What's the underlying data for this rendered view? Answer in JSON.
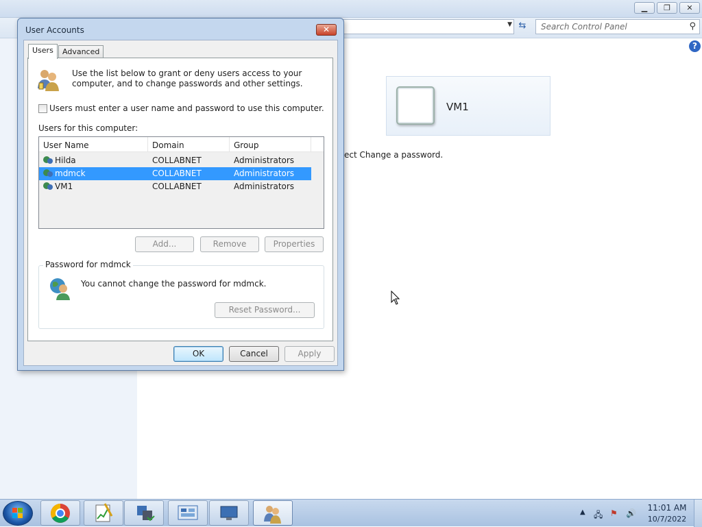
{
  "background_window": {
    "search_placeholder": "Search Control Panel",
    "help_glyph": "?",
    "user_tile_name": "VM1",
    "instruction_text": "ect Change a password."
  },
  "dialog": {
    "title": "User Accounts",
    "close_glyph": "✕",
    "tabs": [
      {
        "label": "Users"
      },
      {
        "label": "Advanced"
      }
    ],
    "intro_text": "Use the list below to grant or deny users access to your computer, and to change passwords and other settings.",
    "must_logon_label": "Users must enter a user name and password to use this computer.",
    "must_logon_checked": false,
    "users_heading": "Users for this computer:",
    "columns": [
      "User Name",
      "Domain",
      "Group"
    ],
    "users": [
      {
        "name": "Hilda",
        "domain": "COLLABNET",
        "group": "Administrators",
        "selected": false
      },
      {
        "name": "mdmck",
        "domain": "COLLABNET",
        "group": "Administrators",
        "selected": true
      },
      {
        "name": "VM1",
        "domain": "COLLABNET",
        "group": "Administrators",
        "selected": false
      }
    ],
    "list_buttons": {
      "add": "Add...",
      "remove": "Remove",
      "properties": "Properties"
    },
    "password_group_label": "Password for mdmck",
    "password_text": "You cannot change the password for mdmck.",
    "reset_password_label": "Reset Password...",
    "footer_buttons": {
      "ok": "OK",
      "cancel": "Cancel",
      "apply": "Apply"
    }
  },
  "taskbar": {
    "apps": [
      "chrome-icon",
      "notepad-chart-icon",
      "network-lock-icon",
      "control-panel-icon",
      "remote-desktop-icon",
      "user-accounts-icon"
    ],
    "clock_time": "11:01 AM",
    "clock_date": "10/7/2022"
  },
  "colors": {
    "selection": "#3399ff",
    "taskbar": "#b9cde6"
  }
}
